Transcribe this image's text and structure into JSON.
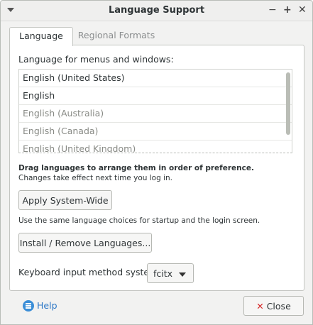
{
  "window": {
    "title": "Language Support"
  },
  "tabs": [
    {
      "label": "Language",
      "active": true
    },
    {
      "label": "Regional Formats",
      "active": false
    }
  ],
  "language": {
    "list_heading": "Language for menus and windows:",
    "items": [
      {
        "label": "English (United States)",
        "enabled": true
      },
      {
        "label": "English",
        "enabled": true
      },
      {
        "label": "English (Australia)",
        "enabled": false
      },
      {
        "label": "English (Canada)",
        "enabled": false
      },
      {
        "label": "English (United Kingdom)",
        "enabled": false
      }
    ],
    "drag_hint": "Drag languages to arrange them in order of preference.",
    "drag_subhint": "Changes take effect next time you log in.",
    "apply_button": "Apply System-Wide",
    "apply_hint": "Use the same language choices for startup and the login screen.",
    "install_button": "Install / Remove Languages...",
    "keyboard_label": "Keyboard input method system:",
    "keyboard_value": "fcitx"
  },
  "footer": {
    "help_label": "Help",
    "close_label": "Close"
  },
  "icons": {
    "window_menu": "chevron-down-icon",
    "minimize": "minimize-icon",
    "maximize": "maximize-icon",
    "close": "close-icon",
    "help": "help-icon",
    "close_button": "close-x-icon"
  },
  "colors": {
    "link": "#2a76c6",
    "close_icon": "#d62727",
    "help_icon": "#3b8ed7"
  }
}
